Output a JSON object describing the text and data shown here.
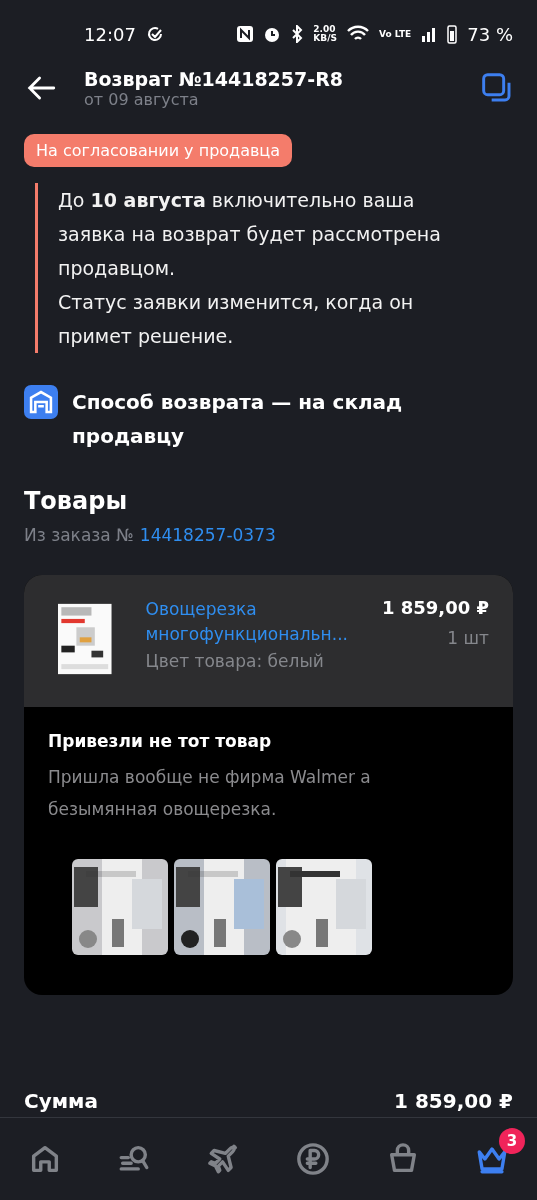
{
  "status_bar": {
    "time": "12:07",
    "speed": "2.00",
    "speed_unit": "KB/S",
    "network": "Vo LTE",
    "battery": "73 %"
  },
  "header": {
    "title": "Возврат №14418257-R8",
    "subtitle": "от 09 августа"
  },
  "status_badge": "На согласовании у продавца",
  "notice": [
    "До **10 августа** включительно ваша заявка на возврат будет рассмотрена продавцом.",
    "Статус заявки изменится, когда он примет решение."
  ],
  "return_method": "Способ возврата — на склад продавцу",
  "goods": {
    "title": "Товары",
    "order_label": "Из заказа №",
    "order_number": "14418257-0373"
  },
  "item": {
    "kind": "picture",
    "name": "Овощерезка многофункциональн...",
    "variant": "Цвет товара: белый",
    "price": "1 859,00 ₽",
    "quantity": "1 шт"
  },
  "reason": {
    "title": "Привезли не тот товар",
    "text": "Пришла вообще не фирма Walmer а безымянная овощерезка."
  },
  "sum": {
    "label": "Сумма",
    "value": "1 859,00 ₽"
  },
  "nav": [
    {
      "kind": "home",
      "selected": false
    },
    {
      "kind": "search",
      "selected": false
    },
    {
      "kind": "travel",
      "selected": false
    },
    {
      "kind": "money",
      "selected": false
    },
    {
      "kind": "basket",
      "selected": false
    },
    {
      "kind": "crown",
      "selected": true,
      "badge": "3"
    }
  ]
}
